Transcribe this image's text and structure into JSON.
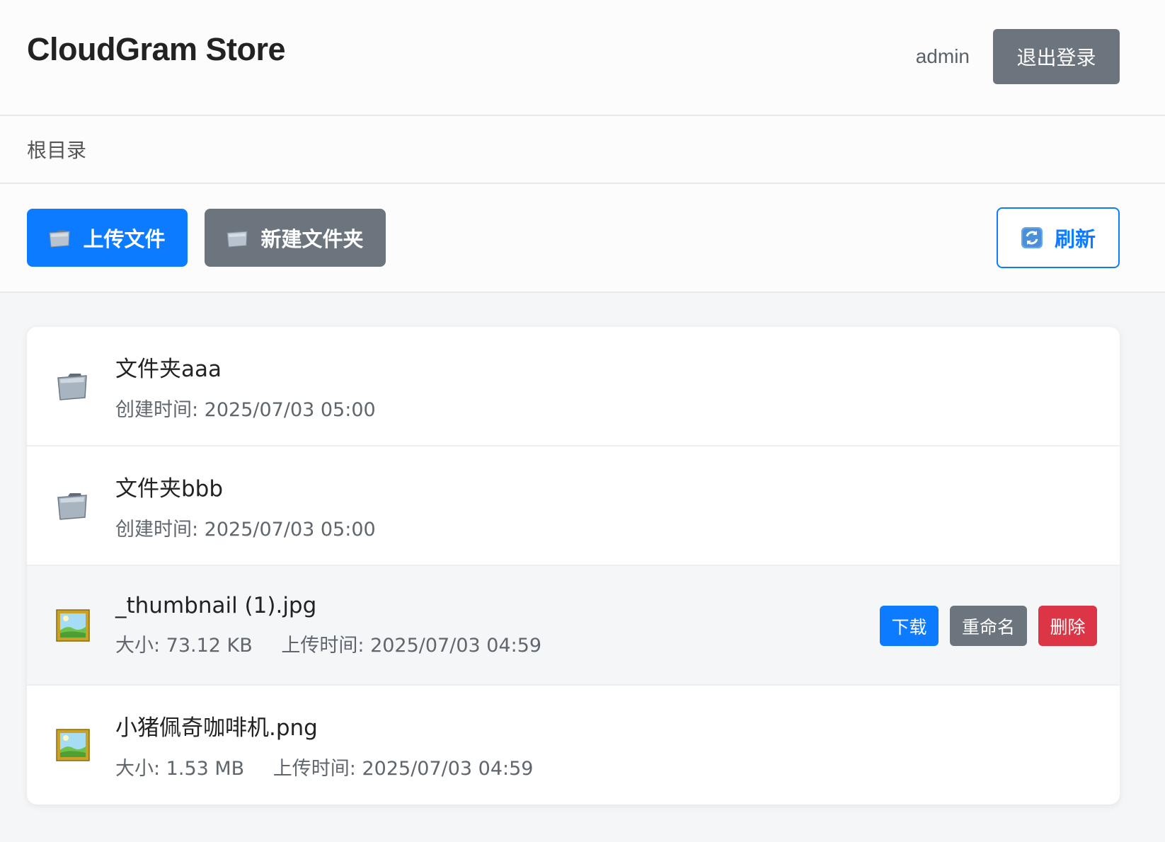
{
  "header": {
    "title": "CloudGram Store",
    "username": "admin",
    "logout_label": "退出登录"
  },
  "breadcrumb": {
    "current": "根目录"
  },
  "toolbar": {
    "upload_label": "上传文件",
    "new_folder_label": "新建文件夹",
    "refresh_label": "刷新",
    "upload_icon": "folder-icon",
    "new_folder_icon": "folder-icon",
    "refresh_icon": "refresh-icon"
  },
  "items": [
    {
      "type": "folder",
      "icon": "folder-icon",
      "name": "文件夹aaa",
      "meta1": "创建时间: 2025/07/03 05:00"
    },
    {
      "type": "folder",
      "icon": "folder-icon",
      "name": "文件夹bbb",
      "meta1": "创建时间: 2025/07/03 05:00"
    },
    {
      "type": "file",
      "icon": "image-icon",
      "name": "_thumbnail (1).jpg",
      "meta1": "大小: 73.12 KB",
      "meta2": "上传时间: 2025/07/03 04:59"
    },
    {
      "type": "file",
      "icon": "image-icon",
      "name": "小猪佩奇咖啡机.png",
      "meta1": "大小: 1.53 MB",
      "meta2": "上传时间: 2025/07/03 04:59"
    }
  ],
  "row_actions": {
    "download_label": "下载",
    "rename_label": "重命名",
    "delete_label": "删除"
  },
  "colors": {
    "primary": "#0d7bff",
    "secondary": "#6c757d",
    "danger": "#dc3545"
  }
}
